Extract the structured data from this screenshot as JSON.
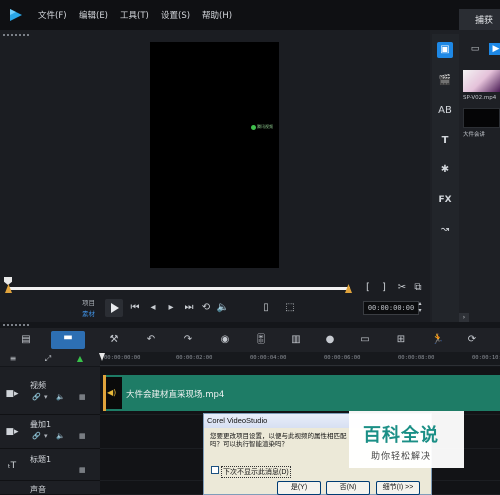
{
  "menu": [
    "文件(F)",
    "编辑(E)",
    "工具(T)",
    "设置(S)",
    "帮助(H)"
  ],
  "capture_tab": "捕获",
  "player": {
    "mode_project": "项目",
    "mode_clip": "素材",
    "timecode": "00:00:00:00",
    "watermark_text": "腾讯视频"
  },
  "library": {
    "items": [
      {
        "label": "SP-V02.mp4"
      },
      {
        "label": "大件会讲"
      }
    ],
    "expand_arrow": "›"
  },
  "ruler": [
    "00:00:00:00",
    "00:00:02:00",
    "00:00:04:00",
    "00:00:06:00",
    "00:00:08:00",
    "00:00:10:00"
  ],
  "tracks": [
    {
      "name": "视频"
    },
    {
      "name": "叠加1"
    },
    {
      "name": "标题1"
    },
    {
      "name": "声音"
    }
  ],
  "clip": {
    "label": "大件会建材直采现场.mp4"
  },
  "dialog": {
    "title": "Corel VideoStudio",
    "message": "您要更改项目设置，以便与此视频的属性相匹配吗？可以执行智能渲染吗？",
    "checkbox_label": "下次不显示此消息(D)",
    "yes": "是(Y)",
    "no": "否(N)",
    "details": "细节(I) >>"
  },
  "overlay": {
    "title": "百科全说",
    "subtitle": "助你轻松解决"
  },
  "colors": {
    "accent": "#1e88e5",
    "clip": "#1e7c66",
    "trim": "#e0a33c"
  }
}
